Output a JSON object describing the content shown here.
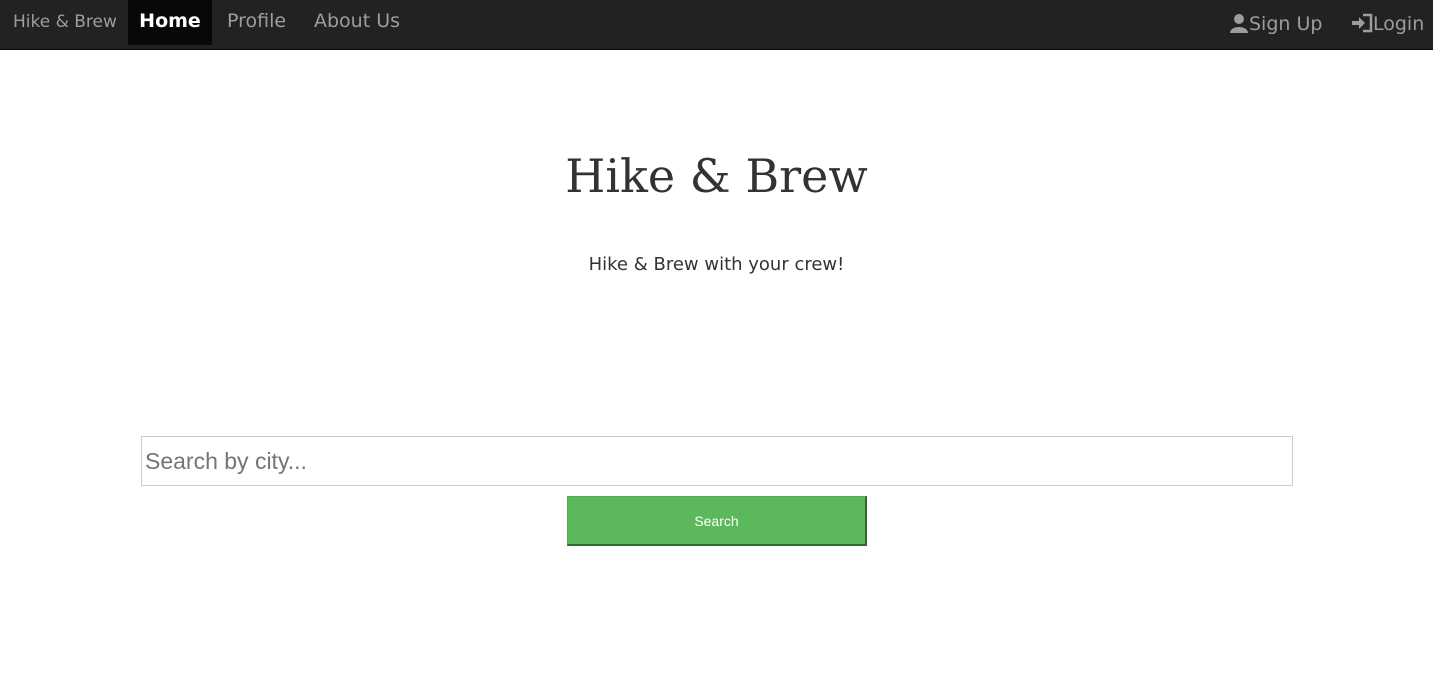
{
  "navbar": {
    "brand": "Hike & Brew",
    "items": [
      {
        "label": "Home",
        "active": true
      },
      {
        "label": "Profile",
        "active": false
      },
      {
        "label": "About Us",
        "active": false
      }
    ],
    "right": {
      "signup": {
        "label": "Sign Up",
        "icon": "user-icon"
      },
      "login": {
        "label": "Login",
        "icon": "login-icon"
      }
    }
  },
  "hero": {
    "title": "Hike & Brew",
    "subtitle": "Hike & Brew with your crew!"
  },
  "search": {
    "placeholder": "Search by city...",
    "value": "",
    "button_label": "Search"
  },
  "colors": {
    "navbar_bg": "#222222",
    "nav_active_bg": "#080808",
    "nav_text": "#9d9d9d",
    "button_green": "#5cb85c"
  }
}
